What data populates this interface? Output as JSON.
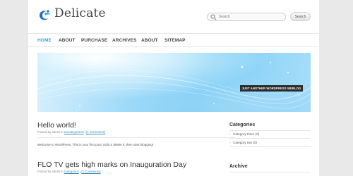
{
  "site": {
    "title": "Delicate",
    "tagline": "JUST ANOTHER WORDPRESS WEBLOG"
  },
  "search": {
    "placeholder": "Search",
    "button_label": "Search"
  },
  "nav": {
    "items": [
      {
        "label": "HOME",
        "active": true
      },
      {
        "label": "ABOUT"
      },
      {
        "label": "PURCHASE"
      },
      {
        "label": "ARCHIVES"
      },
      {
        "label": "ABOUT"
      },
      {
        "label": "SITEMAP"
      }
    ]
  },
  "posts": [
    {
      "title": "Hello world!",
      "meta_prefix": "Posted by admin in",
      "category": "Uncategorized",
      "comments": "(1 Comments)",
      "excerpt": "Welcome to WordPress. This is your first post. Edit or delete it, then start blogging!"
    },
    {
      "title": "FLO TV gets high marks on Inauguration Day",
      "meta_prefix": "Posted by admin in",
      "category": "Category 5",
      "comments": "(1 Comments)"
    }
  ],
  "sidebar": {
    "categories_title": "Categories",
    "categories": [
      {
        "label": "Category three (0)"
      },
      {
        "label": "Category two (0)"
      }
    ],
    "archive_title": "Archive"
  },
  "colors": {
    "accent": "#2fa7dc",
    "tagline_bg": "#2b2b2b",
    "link": "#3b8ec0"
  },
  "icons": {
    "logo": "bird-swirl-icon",
    "search": "magnifier-icon",
    "bullet": "arrow-bullet-icon"
  }
}
